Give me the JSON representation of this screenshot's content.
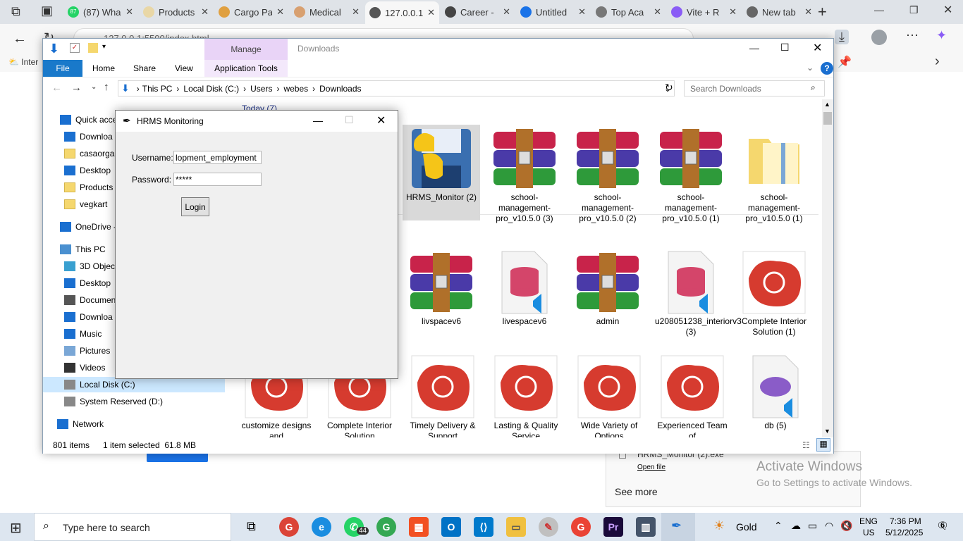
{
  "browser": {
    "tabs": [
      {
        "label": "(87) Wha",
        "color": "#25d366",
        "badge": "87"
      },
      {
        "label": "Products",
        "color": "#e9d7a6"
      },
      {
        "label": "Cargo Pa",
        "color": "#e0a040"
      },
      {
        "label": "Medical",
        "color": "#d8a070"
      },
      {
        "label": "127.0.0.1",
        "color": "#555555",
        "active": true
      },
      {
        "label": "Career -",
        "color": "#444444"
      },
      {
        "label": "Untitled",
        "color": "#1a73e8"
      },
      {
        "label": "Top Aca",
        "color": "#777777"
      },
      {
        "label": "Vite + R",
        "color": "#8a5cf6"
      },
      {
        "label": "New tab",
        "color": "#666666"
      }
    ],
    "address": "127.0.0.1:5500/index.html",
    "bookmark_visible": "Inter"
  },
  "explorer": {
    "ribbon_context_tab": "Manage",
    "window_title": "Downloads",
    "tabs": [
      "File",
      "Home",
      "Share",
      "View",
      "Application Tools"
    ],
    "breadcrumb": [
      "This PC",
      "Local Disk (C:)",
      "Users",
      "webes",
      "Downloads"
    ],
    "search_placeholder": "Search Downloads",
    "group_header": "Today (7)",
    "sidebar": [
      {
        "label": "Quick acce",
        "icon": "star-icon"
      },
      {
        "label": "Downloa",
        "icon": "download-arrow-icon"
      },
      {
        "label": "casaorgar",
        "icon": "folder-icon"
      },
      {
        "label": "Desktop",
        "icon": "desktop-icon"
      },
      {
        "label": "Products",
        "icon": "folder-icon"
      },
      {
        "label": "vegkart",
        "icon": "folder-icon"
      },
      {
        "label": "OneDrive -",
        "icon": "cloud-icon"
      },
      {
        "label": "This PC",
        "icon": "computer-icon"
      },
      {
        "label": "3D Object",
        "icon": "cube-icon"
      },
      {
        "label": "Desktop",
        "icon": "desktop-icon"
      },
      {
        "label": "Documen",
        "icon": "document-icon"
      },
      {
        "label": "Downloa",
        "icon": "download-arrow-icon"
      },
      {
        "label": "Music",
        "icon": "music-icon"
      },
      {
        "label": "Pictures",
        "icon": "picture-icon"
      },
      {
        "label": "Videos",
        "icon": "video-icon"
      },
      {
        "label": "Local Disk (C:)",
        "icon": "drive-icon"
      },
      {
        "label": "System Reserved (D:)",
        "icon": "drive-icon"
      },
      {
        "label": "Network",
        "icon": "network-icon"
      }
    ],
    "files_row1": [
      {
        "name": "HRMS_Monitor (2)",
        "type": "python-icon"
      },
      {
        "name": "school-management-pro_v10.5.0 (3)",
        "type": "winrar-icon"
      },
      {
        "name": "school-management-pro_v10.5.0 (2)",
        "type": "winrar-icon"
      },
      {
        "name": "school-management-pro_v10.5.0 (1)",
        "type": "winrar-icon"
      },
      {
        "name": "school-management-pro_v10.5.0 (1)",
        "type": "folder-zip-icon"
      }
    ],
    "files_row2": [
      {
        "name": "livspacev6",
        "type": "winrar-icon"
      },
      {
        "name": "livespacev6",
        "type": "sql-icon"
      },
      {
        "name": "admin",
        "type": "winrar-icon"
      },
      {
        "name": "u208051238_interiorv3 (3)",
        "type": "sql-icon"
      },
      {
        "name": "Complete Interior Solution (1)",
        "type": "red-badge-icon"
      }
    ],
    "files_row3": [
      {
        "name": "customize designs and",
        "type": "red-badge-icon"
      },
      {
        "name": "Complete Interior Solution",
        "type": "red-badge-icon"
      },
      {
        "name": "Timely Delivery & Support",
        "type": "red-badge-icon"
      },
      {
        "name": "Lasting & Quality Service",
        "type": "red-badge-icon"
      },
      {
        "name": "Wide Variety of Options",
        "type": "red-badge-icon"
      },
      {
        "name": "Experienced Team of",
        "type": "red-badge-icon"
      },
      {
        "name": "db (5)",
        "type": "php-icon"
      }
    ],
    "status_count": "801 items",
    "status_selected": "1 item selected  61.8 MB"
  },
  "dialog": {
    "title": "HRMS Monitoring",
    "username_label": "Username:",
    "username_value": "lopment_employment",
    "password_label": "Password:",
    "password_value": "*****",
    "login_label": "Login"
  },
  "downloads_panel": {
    "file": "HRMS_Monitor (2).exe",
    "open_file": "Open file",
    "see_more": "See more"
  },
  "watermark": {
    "line1": "Activate Windows",
    "line2": "Go to Settings to activate Windows."
  },
  "taskbar": {
    "search_placeholder": "Type here to search",
    "whatsapp_badge": "44",
    "weather": "Gold",
    "lang1": "ENG",
    "lang2": "US",
    "time": "7:36 PM",
    "date": "5/12/2025",
    "notif_count": "6"
  }
}
